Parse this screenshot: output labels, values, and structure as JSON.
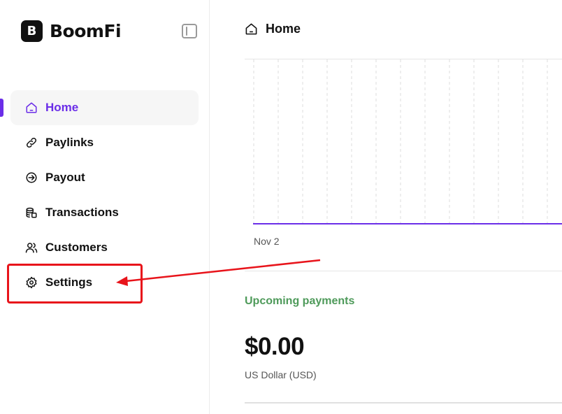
{
  "app": {
    "logo_mark": "B",
    "brand": "BoomFi"
  },
  "sidebar": {
    "collapse_icon": "sidebar-toggle-icon",
    "items": [
      {
        "label": "Home",
        "icon": "home-icon",
        "active": true
      },
      {
        "label": "Paylinks",
        "icon": "link-icon",
        "active": false
      },
      {
        "label": "Payout",
        "icon": "payout-arrow-icon",
        "active": false
      },
      {
        "label": "Transactions",
        "icon": "coins-icon",
        "active": false
      },
      {
        "label": "Customers",
        "icon": "users-icon",
        "active": false
      },
      {
        "label": "Settings",
        "icon": "gear-icon",
        "active": false
      }
    ]
  },
  "header": {
    "title": "Home",
    "icon": "home-icon"
  },
  "chart_data": {
    "type": "line",
    "categories": [
      "Nov 2"
    ],
    "series": [
      {
        "values": [
          0
        ]
      }
    ],
    "xlabel": "",
    "ylabel": "",
    "grid": true
  },
  "upcoming": {
    "title": "Upcoming payments",
    "amount": "$0.00",
    "currency": "US Dollar (USD)"
  },
  "colors": {
    "accent": "#6b2ee8",
    "upcoming_green": "#4e9a5a",
    "annotation_red": "#e8141b"
  }
}
